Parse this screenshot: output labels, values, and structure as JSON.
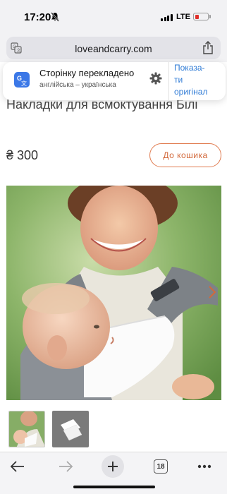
{
  "status_bar": {
    "time": "17:20",
    "network": "LTE"
  },
  "address_bar": {
    "url": "loveandcarry.com"
  },
  "translate_banner": {
    "title": "Сторінку перекладено",
    "subtitle": "англійська – українська",
    "action_line1": "Показа-",
    "action_line2": "ти",
    "action_line3": "оригінал"
  },
  "product": {
    "title": "Накладки для всмоктування Білі",
    "price": "₴ 300",
    "cart_button": "До кошика"
  },
  "toolbar": {
    "tab_count": "18"
  },
  "colors": {
    "accent_orange": "#d2693b",
    "link_blue": "#2f7bd6",
    "chrome_bg": "#f2f2f4"
  },
  "icons": [
    "translate-icon",
    "share-icon",
    "settings-icon",
    "back-arrow-icon",
    "forward-arrow-icon",
    "new-tab-icon",
    "tabs-icon",
    "more-icon",
    "chevron-right-icon"
  ]
}
